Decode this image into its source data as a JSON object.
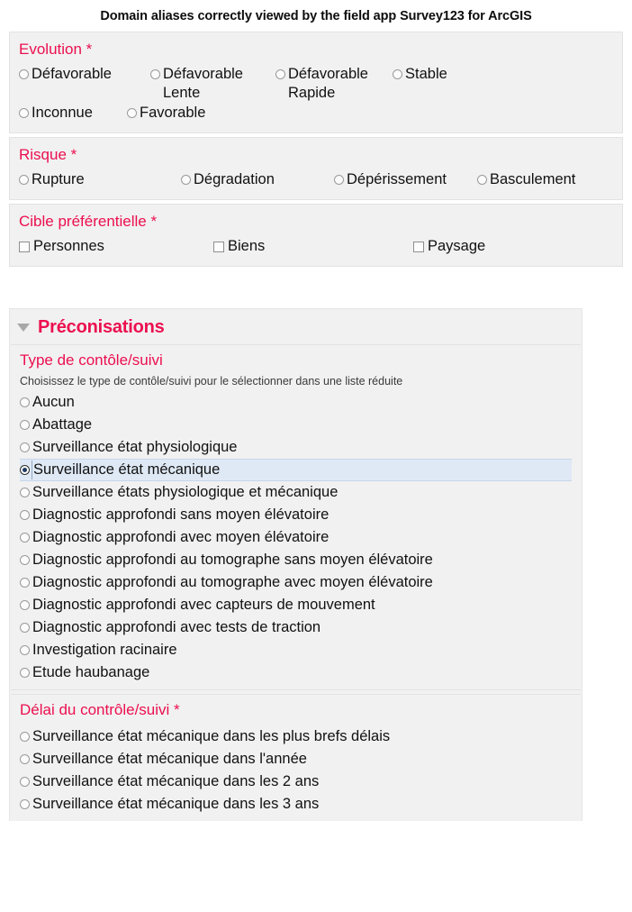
{
  "caption": "Domain aliases correctly viewed by the field app Survey123 for ArcGIS",
  "colors": {
    "label_pink": "#ec0f4f",
    "card_background": "#f1f1f1",
    "card_border": "#e2e2e2",
    "selected_row_background": "#dfe9f5",
    "selected_radio_dot": "#1f3c63"
  },
  "form": {
    "questions": [
      {
        "label": "Evolution *",
        "control": "radio",
        "options": [
          {
            "text": "Défavorable",
            "checked": false
          },
          {
            "text": "Défavorable Lente",
            "checked": false
          },
          {
            "text": "Défavorable Rapide",
            "checked": false
          },
          {
            "text": "Stable",
            "checked": false
          },
          {
            "text": "Inconnue",
            "checked": false
          },
          {
            "text": "Favorable",
            "checked": false
          }
        ]
      },
      {
        "label": "Risque *",
        "control": "radio",
        "options": [
          {
            "text": "Rupture",
            "checked": false
          },
          {
            "text": "Dégradation",
            "checked": false
          },
          {
            "text": "Dépérissement",
            "checked": false
          },
          {
            "text": "Basculement",
            "checked": false
          }
        ]
      },
      {
        "label": "Cible préférentielle *",
        "control": "checkbox",
        "options": [
          {
            "text": "Personnes",
            "checked": false
          },
          {
            "text": "Biens",
            "checked": false
          },
          {
            "text": "Paysage",
            "checked": false
          }
        ]
      }
    ]
  },
  "group": {
    "title": "Préconisations",
    "collapse_icon": "triangle-down-icon",
    "expanded": true,
    "questions": [
      {
        "label": "Type de contôle/suivi",
        "hint": "Choisissez le type de contôle/suivi pour le sélectionner dans une liste réduite",
        "control": "radio",
        "options": [
          {
            "text": "Aucun",
            "checked": false
          },
          {
            "text": "Abattage",
            "checked": false
          },
          {
            "text": "Surveillance état physiologique",
            "checked": false
          },
          {
            "text": "Surveillance état mécanique",
            "checked": true
          },
          {
            "text": "Surveillance états physiologique et mécanique",
            "checked": false
          },
          {
            "text": "Diagnostic approfondi sans moyen élévatoire",
            "checked": false
          },
          {
            "text": "Diagnostic approfondi avec moyen élévatoire",
            "checked": false
          },
          {
            "text": "Diagnostic approfondi au tomographe sans moyen élévatoire",
            "checked": false
          },
          {
            "text": "Diagnostic approfondi au tomographe avec moyen élévatoire",
            "checked": false
          },
          {
            "text": "Diagnostic approfondi avec capteurs de mouvement",
            "checked": false
          },
          {
            "text": "Diagnostic approfondi avec tests de traction",
            "checked": false
          },
          {
            "text": "Investigation racinaire",
            "checked": false
          },
          {
            "text": "Etude haubanage",
            "checked": false
          }
        ]
      },
      {
        "label": "Délai du contrôle/suivi *",
        "hint": "",
        "control": "radio",
        "options": [
          {
            "text": "Surveillance état mécanique dans les plus brefs délais",
            "checked": false
          },
          {
            "text": "Surveillance état mécanique dans l'année",
            "checked": false
          },
          {
            "text": "Surveillance état mécanique dans les 2 ans",
            "checked": false
          },
          {
            "text": "Surveillance état mécanique dans les 3 ans",
            "checked": false
          }
        ]
      }
    ]
  }
}
